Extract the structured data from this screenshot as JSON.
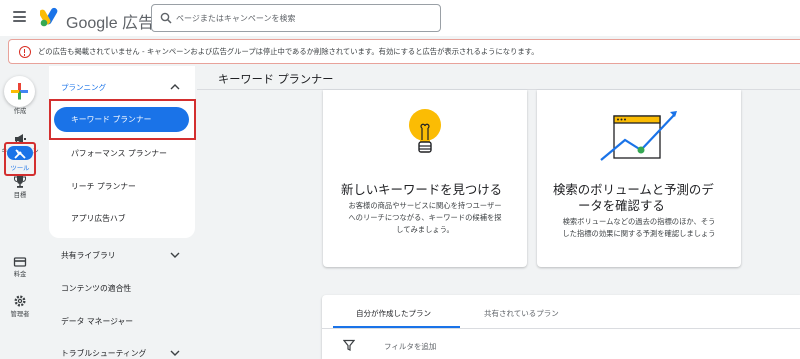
{
  "topbar": {
    "menu_icon": "hamburger-menu-icon",
    "brand": "Google 広告",
    "search_placeholder": "ページまたはキャンペーンを検索"
  },
  "banner": {
    "icon": "error-outline-icon",
    "message": "どの広告も掲載されていません - キャンペーンおよび広告グループは停止中であるか削除されています。有効にすると広告が表示されるようになります。"
  },
  "rail": {
    "items": [
      {
        "label": "作成",
        "icon": "plus-icon"
      },
      {
        "label": "キャンペーン",
        "icon": "megaphone-icon"
      },
      {
        "label": "目標",
        "icon": "trophy-icon"
      },
      {
        "label": "ツール",
        "icon": "tools-icon",
        "selected": true
      },
      {
        "label": "料金",
        "icon": "credit-card-icon"
      },
      {
        "label": "管理者",
        "icon": "gear-icon"
      }
    ]
  },
  "nav": {
    "planning_label": "プランニング",
    "planning_items": [
      "キーワード プランナー",
      "パフォーマンス プランナー",
      "リーチ プランナー",
      "アプリ広告ハブ"
    ],
    "sections": [
      "共有ライブラリ",
      "コンテンツの適合性",
      "データ マネージャー",
      "トラブルシューティング"
    ]
  },
  "main": {
    "title": "キーワード プランナー",
    "cards": [
      {
        "icon": "lightbulb-icon",
        "title": "新しいキーワードを見つける",
        "desc_lines": [
          "お客様の商品やサービスに関心を持つユーザー",
          "へのリーチにつながる、キーワードの候補を探",
          "してみましょう。"
        ]
      },
      {
        "icon": "trend-chart-icon",
        "title_lines": [
          "検索のボリュームと予測のデ",
          "ータを確認する"
        ],
        "desc_lines": [
          "検索ボリュームなどの過去の指標のほか、そう",
          "した指標の効果に関する予測を確認しましょう"
        ]
      }
    ],
    "tabs": [
      "自分が作成したプラン",
      "共有されているプラン"
    ],
    "filter_label": "フィルタを追加"
  },
  "colors": {
    "accent": "#1a73e8",
    "highlight_box": "#d32f2f",
    "warning": "#d93025",
    "bulb": "#fbbc04"
  }
}
